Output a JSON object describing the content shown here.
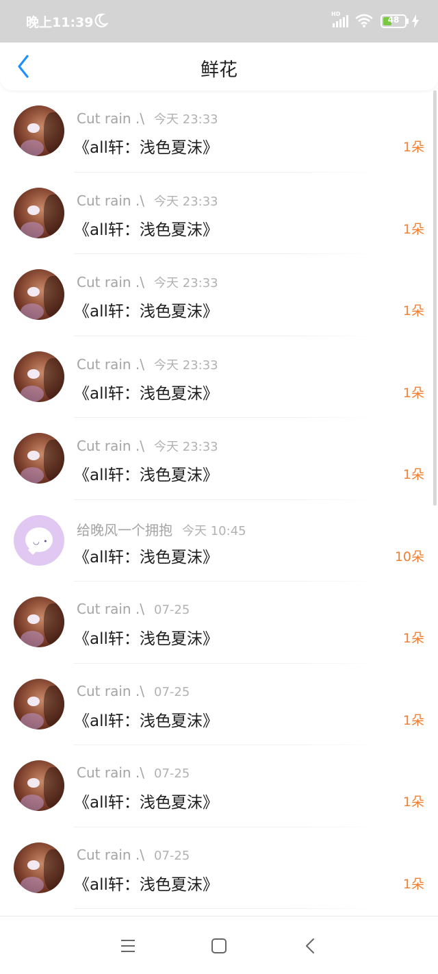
{
  "status_bar": {
    "time": "晚上11:39",
    "network_badge": "HD",
    "battery_level": 48,
    "battery_label": "48",
    "icons": [
      "moon-icon",
      "signal-icon",
      "wifi-icon",
      "battery-icon",
      "charging-bolt-icon"
    ]
  },
  "nav": {
    "title": "鲜花",
    "back_icon": "chevron-left-icon",
    "back_color": "#1e90ff"
  },
  "accent_color": "#f07f32",
  "items": [
    {
      "user": "Cut rain .\\",
      "time": "今天 23:33",
      "title": "《all轩：浅色夏沫》",
      "count": "1朵",
      "avatar": "photo"
    },
    {
      "user": "Cut rain .\\",
      "time": "今天 23:33",
      "title": "《all轩：浅色夏沫》",
      "count": "1朵",
      "avatar": "photo"
    },
    {
      "user": "Cut rain .\\",
      "time": "今天 23:33",
      "title": "《all轩：浅色夏沫》",
      "count": "1朵",
      "avatar": "photo"
    },
    {
      "user": "Cut rain .\\",
      "time": "今天 23:33",
      "title": "《all轩：浅色夏沫》",
      "count": "1朵",
      "avatar": "photo"
    },
    {
      "user": "Cut rain .\\",
      "time": "今天 23:33",
      "title": "《all轩：浅色夏沫》",
      "count": "1朵",
      "avatar": "photo"
    },
    {
      "user": "给晚风一个拥抱",
      "time": "今天 10:45",
      "title": "《all轩：浅色夏沫》",
      "count": "10朵",
      "avatar": "chat-bubble"
    },
    {
      "user": "Cut rain .\\",
      "time": "07-25",
      "title": "《all轩：浅色夏沫》",
      "count": "1朵",
      "avatar": "photo"
    },
    {
      "user": "Cut rain .\\",
      "time": "07-25",
      "title": "《all轩：浅色夏沫》",
      "count": "1朵",
      "avatar": "photo"
    },
    {
      "user": "Cut rain .\\",
      "time": "07-25",
      "title": "《all轩：浅色夏沫》",
      "count": "1朵",
      "avatar": "photo"
    },
    {
      "user": "Cut rain .\\",
      "time": "07-25",
      "title": "《all轩：浅色夏沫》",
      "count": "1朵",
      "avatar": "photo"
    }
  ],
  "system_nav": {
    "icons": [
      "menu-icon",
      "home-square-icon",
      "back-triangle-icon"
    ]
  }
}
